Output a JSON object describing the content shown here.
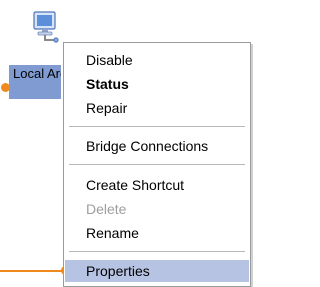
{
  "desktop_icon": {
    "label": "Local Area Connection",
    "icon": "network-connection-icon"
  },
  "context_menu": {
    "items": [
      {
        "label": "Disable",
        "bold": false,
        "enabled": true
      },
      {
        "label": "Status",
        "bold": true,
        "enabled": true
      },
      {
        "label": "Repair",
        "bold": false,
        "enabled": true
      },
      {
        "label": "Bridge Connections",
        "bold": false,
        "enabled": true
      },
      {
        "label": "Create Shortcut",
        "bold": false,
        "enabled": true
      },
      {
        "label": "Delete",
        "bold": false,
        "enabled": false
      },
      {
        "label": "Rename",
        "bold": false,
        "enabled": true
      },
      {
        "label": "Properties",
        "bold": false,
        "enabled": true,
        "selected": true
      }
    ]
  },
  "colors": {
    "callout": "#ef8a1e",
    "label_selection": "#7f9bd1",
    "menu_highlight": "#b7c3e2",
    "disabled_text": "#9e9e9e"
  }
}
